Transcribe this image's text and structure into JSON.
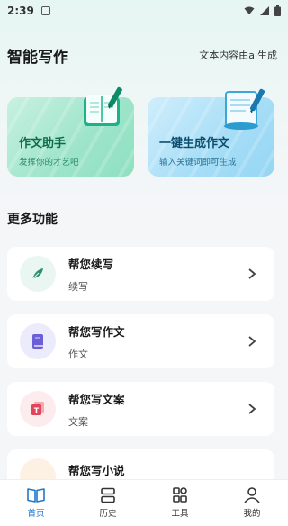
{
  "status_bar": {
    "time": "2:39"
  },
  "header": {
    "title": "智能写作",
    "note": "文本内容由ai生成"
  },
  "cards": [
    {
      "title": "作文助手",
      "subtitle": "发挥你的才艺吧",
      "icon": "notebook-pen-icon",
      "color": "#9de4c9"
    },
    {
      "title": "一键生成作文",
      "subtitle": "输入关键词即可生成",
      "icon": "scroll-pen-icon",
      "color": "#a6ddf6"
    }
  ],
  "section_title": "更多功能",
  "features": [
    {
      "label": "帮您续写",
      "sub": "续写",
      "icon": "feather-icon",
      "icon_bg": "#eaf6f1",
      "icon_color": "#2e8f6a"
    },
    {
      "label": "帮您写作文",
      "sub": "作文",
      "icon": "book-icon",
      "icon_bg": "#ecebfb",
      "icon_color": "#6a5fd6"
    },
    {
      "label": "帮您写文案",
      "sub": "文案",
      "icon": "text-doc-icon",
      "icon_bg": "#fdecee",
      "icon_color": "#e0455a"
    },
    {
      "label": "帮您写小说",
      "sub": "",
      "icon": "novel-icon",
      "icon_bg": "#fdf1e4",
      "icon_color": "#e89a3c"
    }
  ],
  "nav": [
    {
      "label": "首页",
      "icon": "home-book-icon",
      "active": true
    },
    {
      "label": "历史",
      "icon": "history-icon",
      "active": false
    },
    {
      "label": "工具",
      "icon": "tools-grid-icon",
      "active": false
    },
    {
      "label": "我的",
      "icon": "profile-icon",
      "active": false
    }
  ],
  "colors": {
    "accent": "#1f78c8",
    "background": "#f4f6f8"
  }
}
